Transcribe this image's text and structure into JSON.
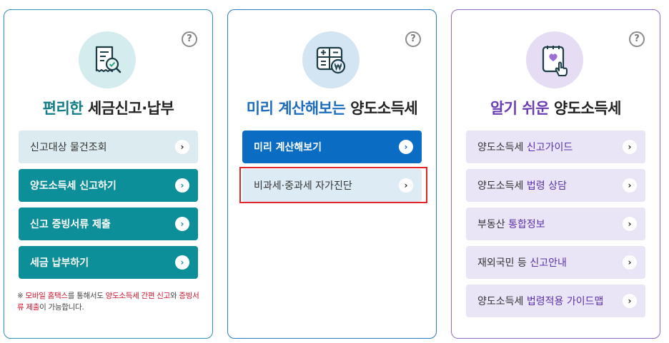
{
  "colors": {
    "teal": "#0d8f9a",
    "blue": "#0b6cc4",
    "purple": "#6a3eb2",
    "selection_outline": "#e0252b"
  },
  "help_symbol": "?",
  "arrow_symbol": "›",
  "card1": {
    "icon": "receipt-search-icon",
    "title_highlight": "편리한",
    "title_rest": " 세금신고·납부",
    "buttons": [
      {
        "label": "신고대상 물건조회",
        "style": "light"
      },
      {
        "label": "양도소득세 신고하기",
        "style": "dark"
      },
      {
        "label": "신고 증빙서류 제출",
        "style": "dark"
      },
      {
        "label": "세금 납부하기",
        "style": "dark"
      }
    ],
    "note": {
      "prefix": "※ ",
      "r1": "모바일 홈택스",
      "t1": "를 통해서도 ",
      "r2": "양도소득세 간편 신고",
      "t2": "와 ",
      "r3": "증빙서류 제출",
      "t3": "이 가능합니다."
    }
  },
  "card2": {
    "icon": "calculator-won-icon",
    "title_highlight": "미리 계산해보는",
    "title_rest": " 양도소득세",
    "buttons": [
      {
        "label": "미리 계산해보기",
        "style": "dark"
      },
      {
        "label": "비과세·중과세 자가진단",
        "style": "light",
        "selected": true
      }
    ]
  },
  "card3": {
    "icon": "heart-document-hand-icon",
    "title_highlight": "알기 쉬운",
    "title_rest": " 양도소득세",
    "buttons": [
      {
        "plain": "양도소득세 ",
        "accent": "신고가이드"
      },
      {
        "plain": "양도소득세 ",
        "accent": "법령 상담"
      },
      {
        "plain": "부동산 ",
        "accent": "통합정보"
      },
      {
        "plain": "재외국민 등 ",
        "accent": "신고안내"
      },
      {
        "plain": "양도소득세 ",
        "accent": "법령적용 가이드맵"
      }
    ]
  }
}
